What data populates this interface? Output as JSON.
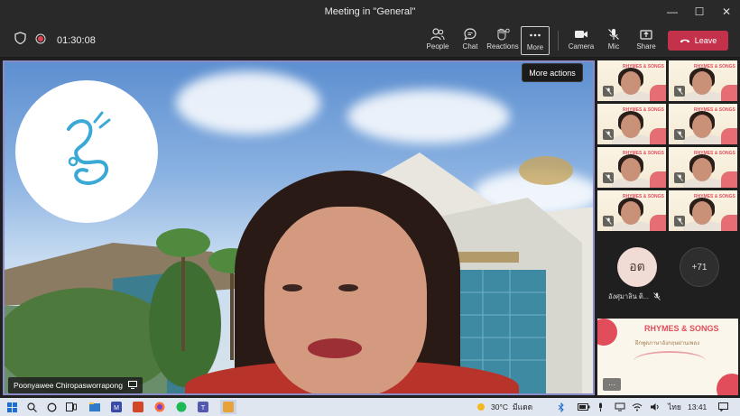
{
  "window": {
    "title": "Meeting in \"General\"",
    "controls": [
      "—",
      "☐",
      "✕"
    ]
  },
  "toolbar": {
    "timer": "01:30:08",
    "buttons": {
      "people": "People",
      "chat": "Chat",
      "reactions": "Reactions",
      "more": "More",
      "camera": "Camera",
      "mic": "Mic",
      "share": "Share"
    },
    "leave": "Leave"
  },
  "tooltip": "More actions",
  "main_video": {
    "speaker_name": "Poonyawee Chiropasworrapong"
  },
  "participants": {
    "tile_header": "RHYMES & SONGS",
    "avatar_initials": "อต",
    "avatar_name": "อังศุมาลิน ติ...",
    "overflow_count": "+71"
  },
  "shared_tile": {
    "title": "RHYMES & SONGS",
    "subtitle": "ฝึกพูดภาษาอังกฤษผ่านเพลง"
  },
  "taskbar": {
    "weather": "30°C",
    "weather_desc": "มีแดด",
    "language": "ไทย",
    "time": "13:41"
  },
  "colors": {
    "leave": "#c4314b",
    "active_border": "#8b8cc7",
    "accent_red": "#e14d5a"
  }
}
